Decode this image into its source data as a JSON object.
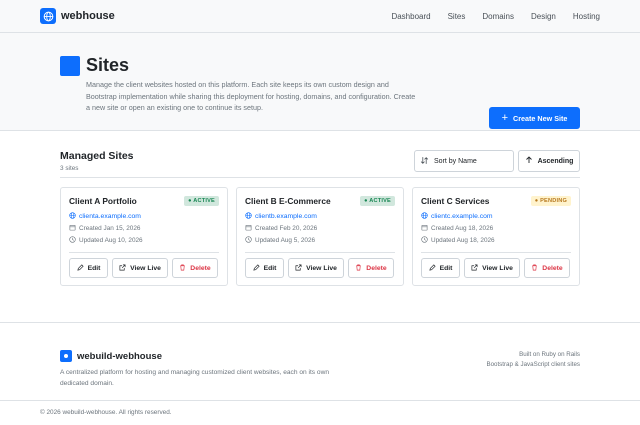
{
  "navbar": {
    "brand": "webhouse",
    "links": [
      "Dashboard",
      "Sites",
      "Domains",
      "Design",
      "Hosting"
    ]
  },
  "hero": {
    "title": "Sites",
    "description": "Manage the client websites hosted on this platform. Each site keeps its own custom design and Bootstrap implementation while sharing this deployment for hosting, domains, and configuration. Create a new site or open an existing one to continue its setup.",
    "create_button": "Create New Site"
  },
  "section": {
    "title": "Managed Sites",
    "count": "3 sites",
    "sort_label": "Sort by Name",
    "order_label": "Ascending"
  },
  "cards": [
    {
      "title": "Client A Portfolio",
      "status": "ACTIVE",
      "url": "clienta.example.com",
      "created": "Created Jan 15, 2026",
      "updated": "Updated Aug 10, 2026"
    },
    {
      "title": "Client B E-Commerce",
      "status": "ACTIVE",
      "url": "clientb.example.com",
      "created": "Created Feb 20, 2026",
      "updated": "Updated Aug 5, 2026"
    },
    {
      "title": "Client C Services",
      "status": "PENDING",
      "url": "clientc.example.com",
      "created": "Created Aug 18, 2026",
      "updated": "Updated Aug 18, 2026"
    }
  ],
  "card_actions": {
    "edit": "Edit",
    "view": "View Live",
    "delete": "Delete"
  },
  "footer": {
    "brand": "webuild-webhouse",
    "description": "A centralized platform for hosting and managing customized client websites, each on its own dedicated domain.",
    "right_line1": "Built on Ruby on Rails",
    "right_line2": "Bootstrap & JavaScript client sites",
    "copyright": "© 2026 webuild-webhouse. All rights reserved."
  },
  "colors": {
    "accent": "#0d6efd",
    "active": "#198754",
    "pending": "#b7791f",
    "danger": "#dc3545"
  },
  "icons": [
    "globe-icon",
    "plus-icon",
    "sort-icon",
    "arrow-up-icon",
    "calendar-icon",
    "clock-icon",
    "pencil-icon",
    "external-link-icon",
    "trash-icon"
  ]
}
